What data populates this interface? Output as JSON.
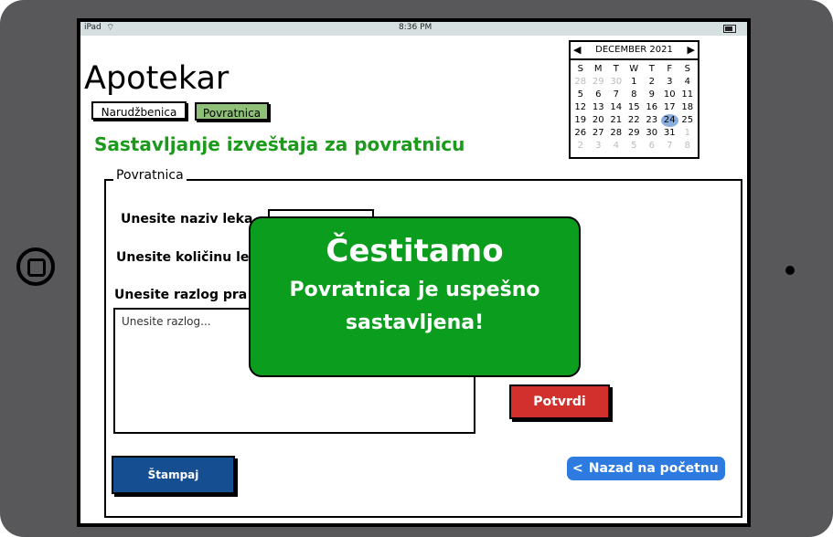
{
  "status_bar": {
    "carrier": "iPad",
    "time": "8:36 PM"
  },
  "app": {
    "title": "Apotekar"
  },
  "tabs": [
    {
      "label": "Narudžbenica"
    },
    {
      "label": "Povratnica"
    }
  ],
  "page": {
    "subtitle": "Sastavljanje izveštaja za povratnicu"
  },
  "calendar": {
    "month_label": "DECEMBER 2021",
    "weekdays": [
      "S",
      "M",
      "T",
      "W",
      "T",
      "F",
      "S"
    ],
    "weeks": [
      [
        "28",
        "29",
        "30",
        "1",
        "2",
        "3",
        "4"
      ],
      [
        "5",
        "6",
        "7",
        "8",
        "9",
        "10",
        "11"
      ],
      [
        "12",
        "13",
        "14",
        "15",
        "16",
        "17",
        "18"
      ],
      [
        "19",
        "20",
        "21",
        "22",
        "23",
        "24",
        "25"
      ],
      [
        "26",
        "27",
        "28",
        "29",
        "30",
        "31",
        "1"
      ],
      [
        "2",
        "3",
        "4",
        "5",
        "6",
        "7",
        "8"
      ]
    ],
    "selected_day": "24"
  },
  "form": {
    "legend": "Povratnica",
    "label_naziv": "Unesite naziv leka",
    "label_kolicina": "Unesite količinu leka",
    "label_razlog": "Unesite razlog pra",
    "razlog_placeholder": "Unesite razlog..."
  },
  "buttons": {
    "potvrdi": "Potvrdi",
    "stampaj": "Štampaj",
    "nazad": "Nazad na početnu"
  },
  "modal": {
    "title": "Čestitamo",
    "line1": "Povratnica je uspešno",
    "line2": "sastavljena!"
  },
  "colors": {
    "accent_green": "#1c9a1c",
    "modal_bg": "#0a9d1e",
    "confirm_red": "#d1302c",
    "print_blue": "#164f91",
    "back_blue": "#2d7be0",
    "tab_active": "#8fc078"
  }
}
